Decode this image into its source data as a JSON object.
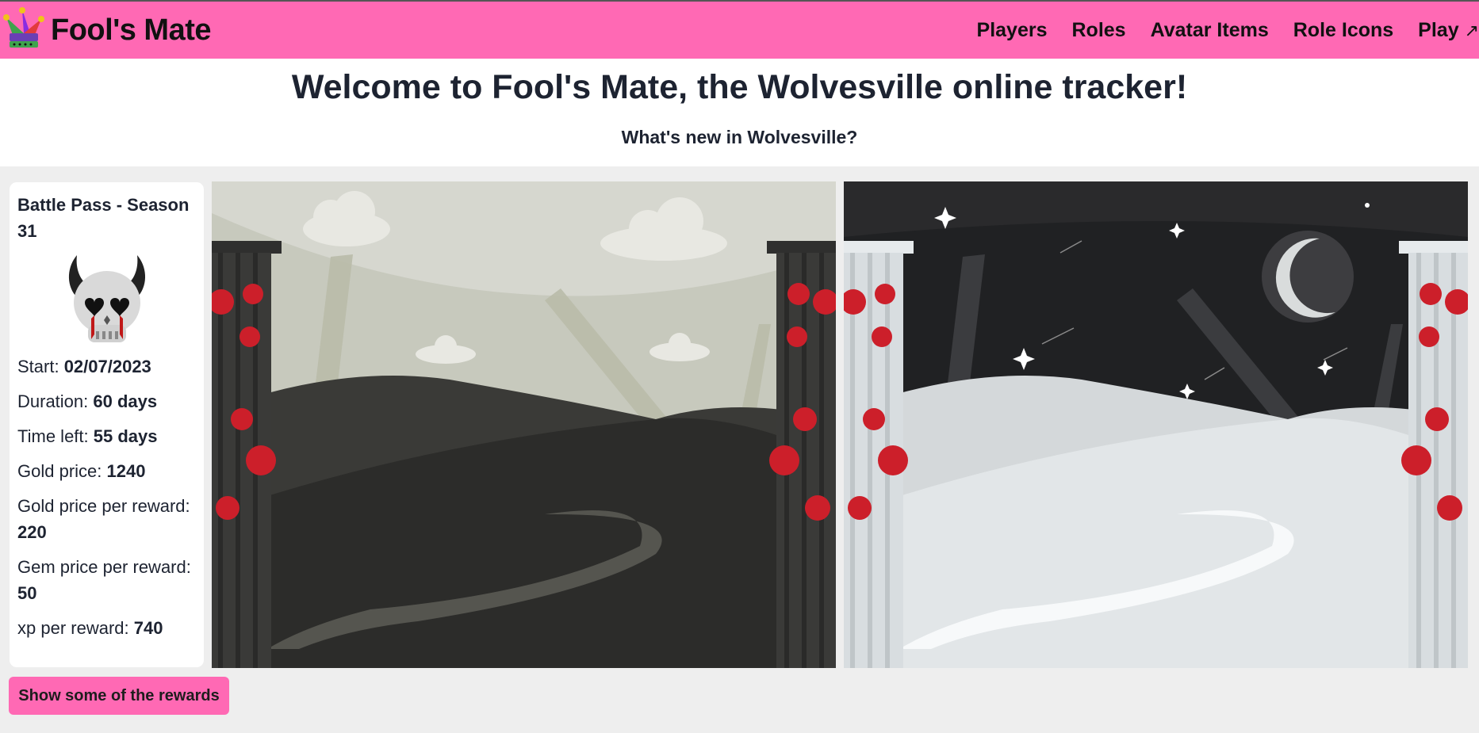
{
  "brand": {
    "name": "Fool's Mate"
  },
  "nav": {
    "links": [
      "Players",
      "Roles",
      "Avatar Items",
      "Role Icons",
      "Play"
    ],
    "external_mark": "↗"
  },
  "hero": {
    "title": "Welcome to Fool's Mate, the Wolvesville online tracker!",
    "subtitle": "What's new in Wolvesville?"
  },
  "battle_pass": {
    "title": "Battle Pass - Season 31",
    "icon": "horned-skull-icon",
    "stats": [
      {
        "label": "Start: ",
        "value": "02/07/2023"
      },
      {
        "label": "Duration: ",
        "value": "60 days"
      },
      {
        "label": "Time left: ",
        "value": "55 days"
      },
      {
        "label": "Gold price: ",
        "value": "1240"
      },
      {
        "label": "Gold price per reward: ",
        "value": "220"
      },
      {
        "label": "Gem price per reward: ",
        "value": "50"
      },
      {
        "label": "xp per reward: ",
        "value": "740"
      }
    ],
    "images": [
      "day-ruins-background",
      "night-ruins-background"
    ]
  },
  "rewards_button": {
    "label": "Show some of the rewards"
  },
  "colors": {
    "accent": "#ff69b4",
    "page_bg": "#eeeeee",
    "text": "#1d2331"
  }
}
